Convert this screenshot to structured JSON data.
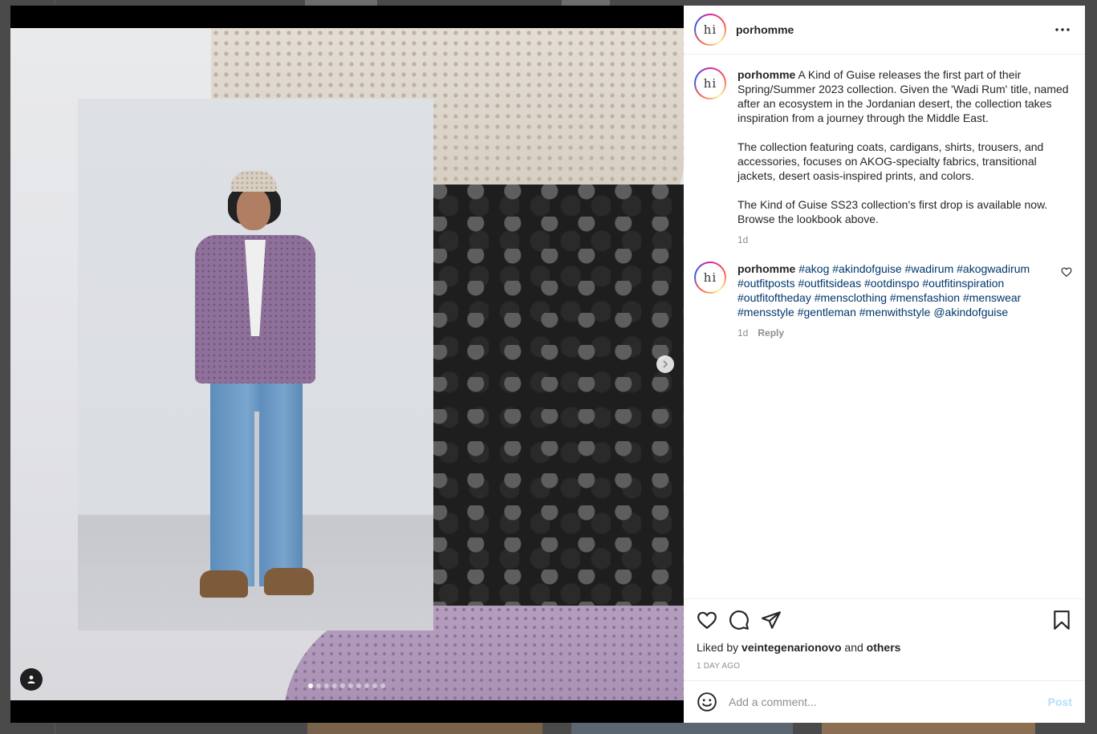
{
  "post": {
    "username": "porhomme",
    "avatar_letters": "hi",
    "caption": "A Kind of Guise releases the first part of their Spring/Summer 2023 collection. Given the 'Wadi Rum' title, named after an ecosystem in the Jordanian desert, the collection takes inspiration from a journey through the Middle East.\n\nThe collection featuring coats, cardigans, shirts, trousers, and accessories, focuses on AKOG-specialty fabrics, transitional jackets, desert oasis-inspired prints, and colors.\n\nThe Kind of Guise SS23 collection's first drop is available now. Browse the lookbook above.",
    "caption_time": "1d"
  },
  "comments": [
    {
      "username": "porhomme",
      "text": "#akog #akindofguise #wadirum #akogwadirum #outfitposts #outfitsideas #ootdinspo #outfitinspiration #outfitoftheday #mensclothing #mensfashion #menswear #mensstyle #gentleman #menwithstyle @akindofguise",
      "time": "1d",
      "reply_label": "Reply"
    }
  ],
  "likes": {
    "prefix": "Liked by",
    "user": "veintegenarionovo",
    "and": "and",
    "others": "others"
  },
  "timestamp": "1 DAY AGO",
  "composer": {
    "placeholder": "Add a comment...",
    "post_label": "Post"
  },
  "carousel": {
    "slide_count": 10,
    "active_index": 0
  },
  "icons": {
    "more": "more-horizontal-icon",
    "like": "heart-icon",
    "comment": "comment-bubble-icon",
    "share": "paper-plane-icon",
    "save": "bookmark-icon",
    "emoji": "smiley-icon",
    "next": "chevron-right-icon",
    "tagged": "user-tag-icon"
  },
  "colors": {
    "link": "#00376b",
    "post_disabled": "#b2dffc",
    "muted": "#8e8e8e"
  }
}
